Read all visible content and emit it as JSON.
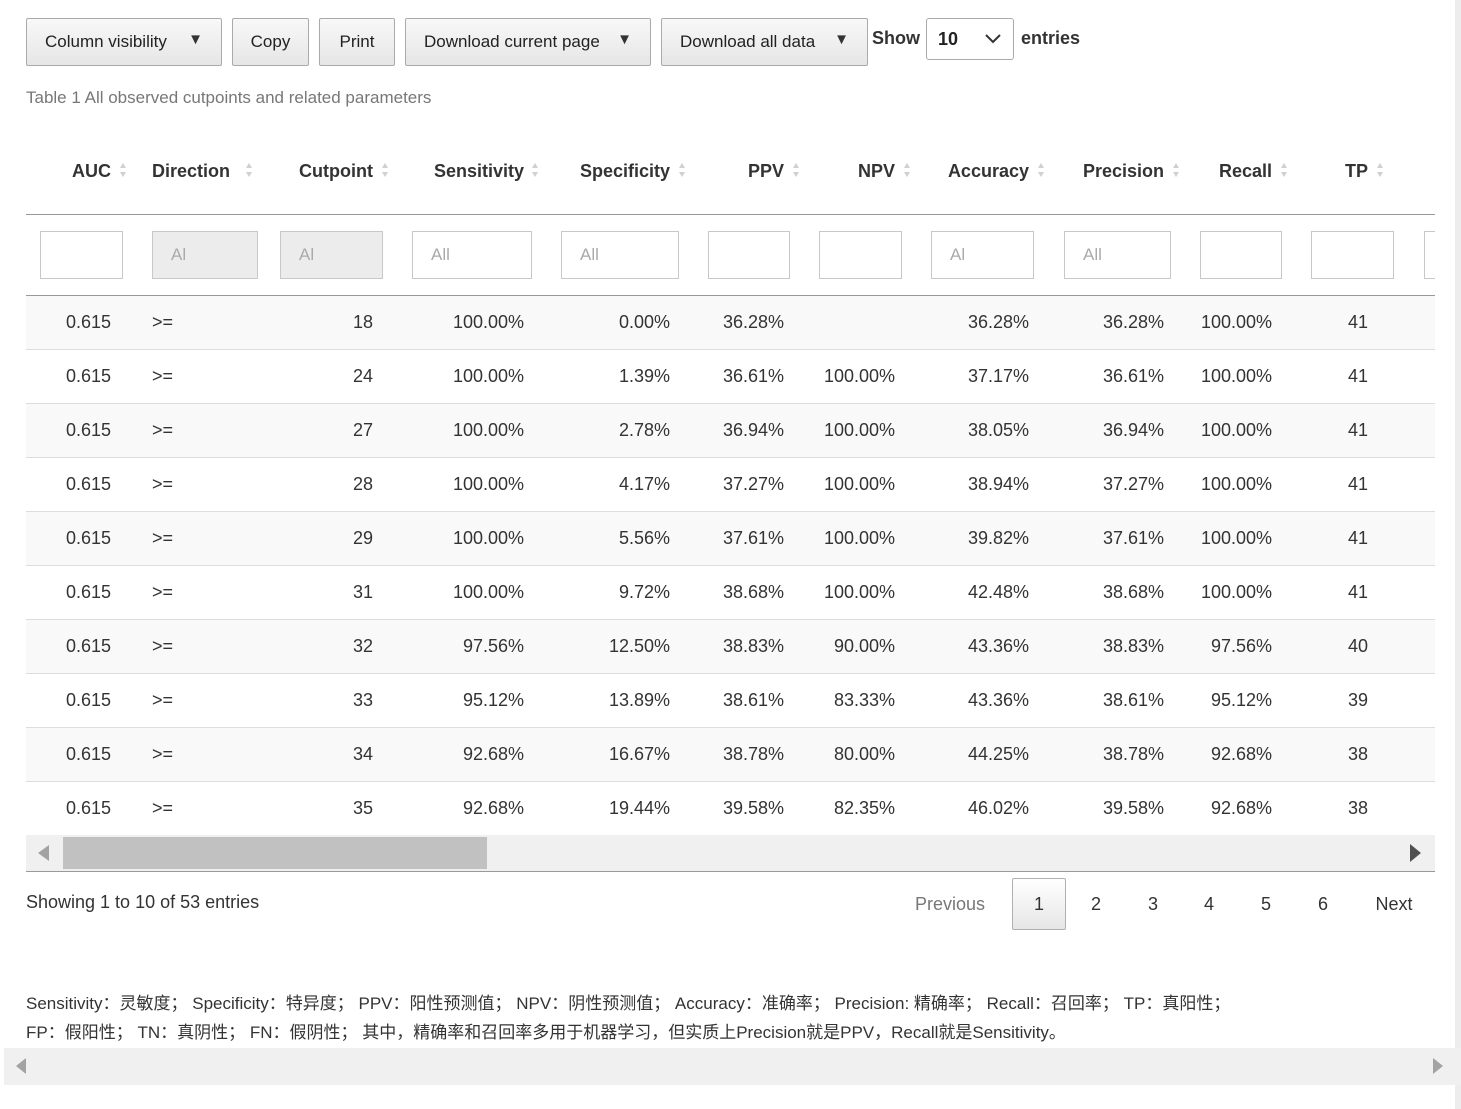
{
  "toolbar": {
    "column_visibility": "Column visibility",
    "copy": "Copy",
    "print": "Print",
    "download_current_page": "Download current page",
    "download_all_data": "Download all data",
    "show_label": "Show",
    "show_value": "10",
    "entries_label": "entries"
  },
  "caption": "Table 1 All observed cutpoints and related parameters",
  "table": {
    "headers": [
      "AUC",
      "Direction",
      "Cutpoint",
      "Sensitivity",
      "Specificity",
      "PPV",
      "NPV",
      "Accuracy",
      "Precision",
      "Recall",
      "TP"
    ],
    "filters": [
      "",
      "Al",
      "Al",
      "All",
      "All",
      "",
      "",
      "Al",
      "All",
      "",
      ""
    ],
    "rows": [
      [
        "0.615",
        ">=",
        "18",
        "100.00%",
        "0.00%",
        "36.28%",
        "",
        "36.28%",
        "36.28%",
        "100.00%",
        "41"
      ],
      [
        "0.615",
        ">=",
        "24",
        "100.00%",
        "1.39%",
        "36.61%",
        "100.00%",
        "37.17%",
        "36.61%",
        "100.00%",
        "41"
      ],
      [
        "0.615",
        ">=",
        "27",
        "100.00%",
        "2.78%",
        "36.94%",
        "100.00%",
        "38.05%",
        "36.94%",
        "100.00%",
        "41"
      ],
      [
        "0.615",
        ">=",
        "28",
        "100.00%",
        "4.17%",
        "37.27%",
        "100.00%",
        "38.94%",
        "37.27%",
        "100.00%",
        "41"
      ],
      [
        "0.615",
        ">=",
        "29",
        "100.00%",
        "5.56%",
        "37.61%",
        "100.00%",
        "39.82%",
        "37.61%",
        "100.00%",
        "41"
      ],
      [
        "0.615",
        ">=",
        "31",
        "100.00%",
        "9.72%",
        "38.68%",
        "100.00%",
        "42.48%",
        "38.68%",
        "100.00%",
        "41"
      ],
      [
        "0.615",
        ">=",
        "32",
        "97.56%",
        "12.50%",
        "38.83%",
        "90.00%",
        "43.36%",
        "38.83%",
        "97.56%",
        "40"
      ],
      [
        "0.615",
        ">=",
        "33",
        "95.12%",
        "13.89%",
        "38.61%",
        "83.33%",
        "43.36%",
        "38.61%",
        "95.12%",
        "39"
      ],
      [
        "0.615",
        ">=",
        "34",
        "92.68%",
        "16.67%",
        "38.78%",
        "80.00%",
        "44.25%",
        "38.78%",
        "92.68%",
        "38"
      ],
      [
        "0.615",
        ">=",
        "35",
        "92.68%",
        "19.44%",
        "39.58%",
        "82.35%",
        "46.02%",
        "39.58%",
        "92.68%",
        "38"
      ]
    ]
  },
  "info": "Showing 1 to 10 of 53 entries",
  "pagination": {
    "previous": "Previous",
    "pages": [
      "1",
      "2",
      "3",
      "4",
      "5",
      "6"
    ],
    "current": "1",
    "next": "Next"
  },
  "footnote": {
    "line1": "Sensitivity：灵敏度； Specificity：特异度； PPV：阳性预测值； NPV：阴性预测值； Accuracy：准确率； Precision: 精确率； Recall：召回率； TP：真阳性；",
    "line2": "FP：假阳性； TN：真阴性； FN：假阴性； 其中，精确率和召回率多用于机器学习，但实质上Precision就是PPV，Recall就是Sensitivity。"
  }
}
